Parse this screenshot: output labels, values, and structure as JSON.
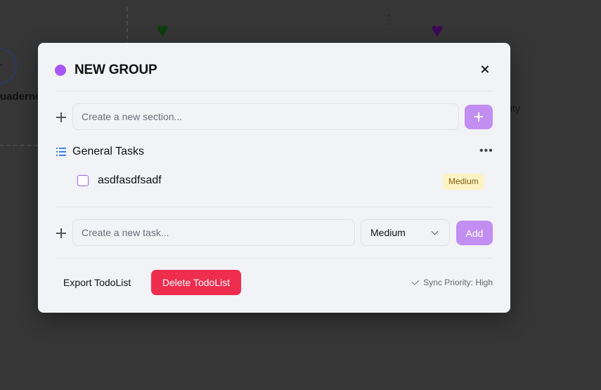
{
  "background": {
    "notebook_label": "uaderno",
    "partial_text": "ity"
  },
  "modal": {
    "title": "NEW GROUP",
    "accent_color": "#a855f7",
    "section_input": {
      "placeholder": "Create a new section..."
    },
    "section": {
      "title": "General Tasks",
      "tasks": [
        {
          "text": "asdfasdfsadf",
          "priority": "Medium",
          "checked": false
        }
      ]
    },
    "task_input": {
      "placeholder": "Create a new task..."
    },
    "priority_select": {
      "value": "Medium"
    },
    "add_label": "Add",
    "export_label": "Export TodoList",
    "delete_label": "Delete TodoList",
    "sync_text": "Sync Priority: High"
  }
}
